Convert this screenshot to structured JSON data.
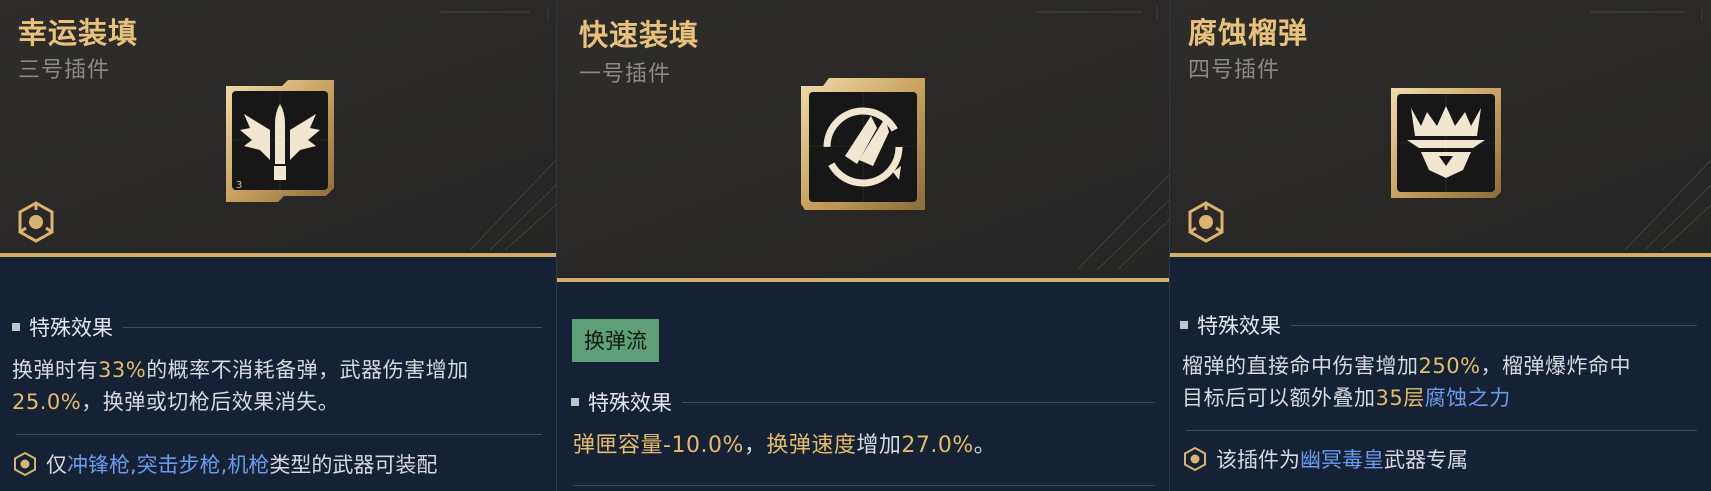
{
  "cards": [
    {
      "title": "幸运装填",
      "subtitle": "三号插件",
      "icon": "winged-bullet-icon",
      "section_title": "特殊效果",
      "effect": {
        "line1_a": "换弹时有",
        "line1_b": "33%",
        "line1_c": "的概率不消耗备弹，武器伤害增加",
        "line2_a": "25.0%",
        "line2_b": "，换弹或切枪后效果消失。"
      },
      "note": {
        "a": "仅",
        "b": "冲锋枪,突击步枪,机枪",
        "c": "类型的武器可装配"
      }
    },
    {
      "title": "快速装填",
      "subtitle": "一号插件",
      "icon": "rocket-reload-icon",
      "tag": "换弹流",
      "section_title": "特殊效果",
      "effect": {
        "a": "弹匣容量",
        "b": "-10.0%",
        "c": "，",
        "d": "换弹速度",
        "e": "增加",
        "f": "27.0%",
        "g": "。"
      }
    },
    {
      "title": "腐蚀榴弹",
      "subtitle": "四号插件",
      "icon": "crowned-emblem-icon",
      "section_title": "特殊效果",
      "effect": {
        "line1_a": "榴弹的直接命中伤害增加",
        "line1_b": "250%",
        "line1_c": "，榴弹爆炸命中",
        "line2_a": "目标后可以额外叠加",
        "line2_b": "35层",
        "line2_c": "腐蚀之力"
      },
      "note": {
        "a": "该插件为",
        "b": "幽冥毒皇",
        "c": "武器专属"
      }
    }
  ],
  "colors": {
    "accent_gold": "#e3bc6a",
    "link_blue": "#6b9bea",
    "tag_green": "#5e9f79",
    "panel_bg": "#152134"
  }
}
